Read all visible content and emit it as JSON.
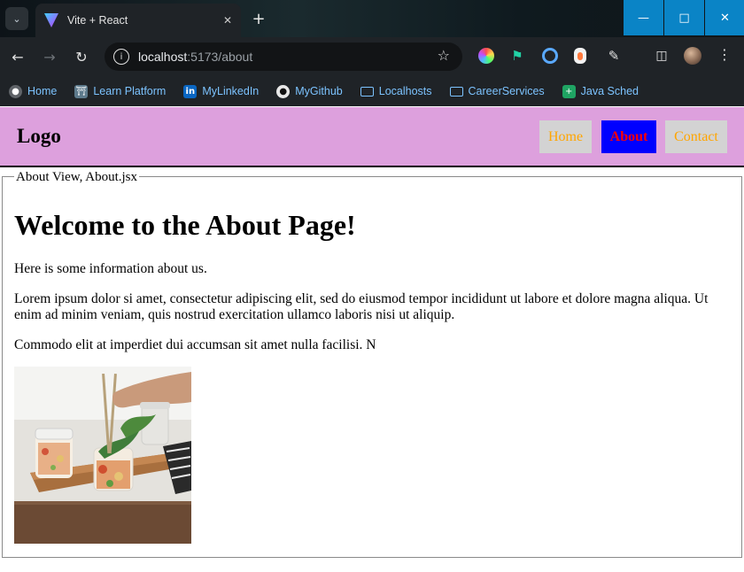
{
  "browser": {
    "tab_title": "Vite + React",
    "url_host": "localhost",
    "url_path": ":5173/about",
    "bookmarks": [
      {
        "label": "Home",
        "icon": "globe-icon"
      },
      {
        "label": "Learn Platform",
        "icon": "learn-platform-icon"
      },
      {
        "label": "MyLinkedIn",
        "icon": "linkedin-icon"
      },
      {
        "label": "MyGithub",
        "icon": "github-icon"
      },
      {
        "label": "Localhosts",
        "icon": "folder-icon"
      },
      {
        "label": "CareerServices",
        "icon": "folder-icon"
      },
      {
        "label": "Java Sched",
        "icon": "google-sheets-icon"
      }
    ],
    "colors": {
      "chrome_bg": "#1f2327",
      "window_controls": "#0a84c6",
      "bookmark_text": "#7cc3ff"
    }
  },
  "header": {
    "logo": "Logo",
    "nav": [
      {
        "label": "Home",
        "active": false
      },
      {
        "label": "About",
        "active": true
      },
      {
        "label": "Contact",
        "active": false
      }
    ],
    "colors": {
      "background": "#dda0dd",
      "link_text": "#ffa500",
      "link_bg": "#d3d3d3",
      "active_bg": "#0000ff",
      "active_text": "#ff0000"
    }
  },
  "main": {
    "legend": "About View, About.jsx",
    "title": "Welcome to the About Page!",
    "paragraphs": [
      "Here is some information about us.",
      "Lorem ipsum dolor si amet, consectetur adipiscing elit, sed do eiusmod tempor incididunt ut labore et dolore magna aliqua. Ut enim ad minim veniam, quis nostrud exercitation ullamco laboris nisi ut aliquip.",
      "Commodo elit at imperdiet dui accumsan sit amet nulla facilisi. N"
    ],
    "image_icon": "food-jars-photo"
  }
}
